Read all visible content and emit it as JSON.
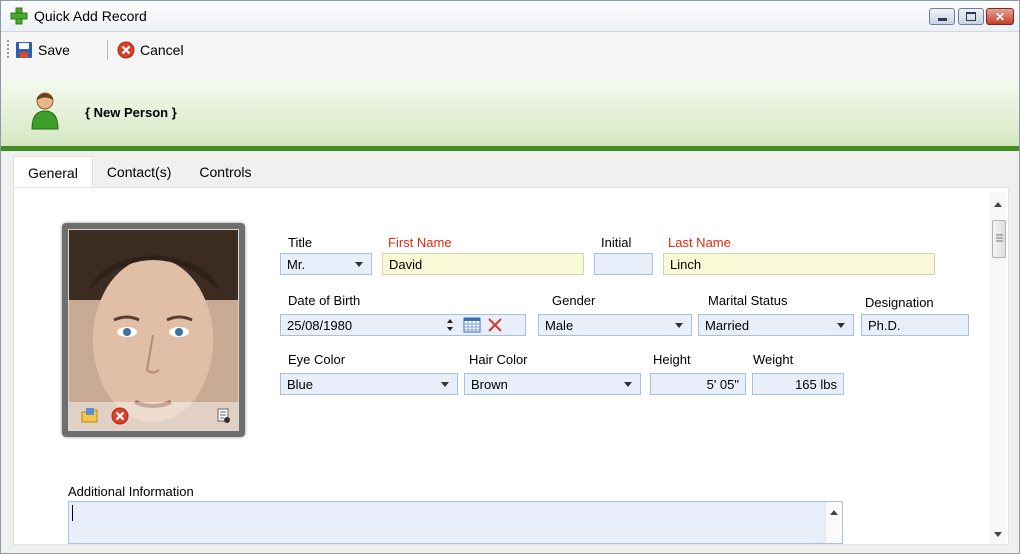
{
  "window": {
    "title": "Quick Add Record"
  },
  "toolbar": {
    "save_label": "Save",
    "cancel_label": "Cancel"
  },
  "header": {
    "person_title": "{ New Person }"
  },
  "tabs": [
    {
      "label": "General"
    },
    {
      "label": "Contact(s)"
    },
    {
      "label": "Controls"
    }
  ],
  "form": {
    "title": {
      "label": "Title",
      "value": "Mr."
    },
    "first_name": {
      "label": "First Name",
      "value": "David"
    },
    "initial": {
      "label": "Initial",
      "value": ""
    },
    "last_name": {
      "label": "Last Name",
      "value": "Linch"
    },
    "dob": {
      "label": "Date of Birth",
      "value": "25/08/1980"
    },
    "gender": {
      "label": "Gender",
      "value": "Male"
    },
    "marital": {
      "label": "Marital Status",
      "value": "Married"
    },
    "designation": {
      "label": "Designation",
      "value": "Ph.D."
    },
    "eye": {
      "label": "Eye Color",
      "value": "Blue"
    },
    "hair": {
      "label": "Hair Color",
      "value": "Brown"
    },
    "height": {
      "label": "Height",
      "value": "5' 05\""
    },
    "weight": {
      "label": "Weight",
      "value": "165 lbs"
    },
    "additional": {
      "label": "Additional Information",
      "value": ""
    }
  },
  "colors": {
    "required_label": "#e02a10",
    "header_accent": "#3f8f1c",
    "required_field_bg": "#fbfad7",
    "field_bg": "#e8effa"
  },
  "icons": [
    "add-record-icon",
    "minimize-icon",
    "maximize-icon",
    "close-icon",
    "save-icon",
    "cancel-icon",
    "person-icon",
    "open-folder-icon",
    "remove-photo-icon",
    "photo-properties-icon",
    "spin-icon",
    "calendar-icon",
    "clear-date-icon"
  ]
}
